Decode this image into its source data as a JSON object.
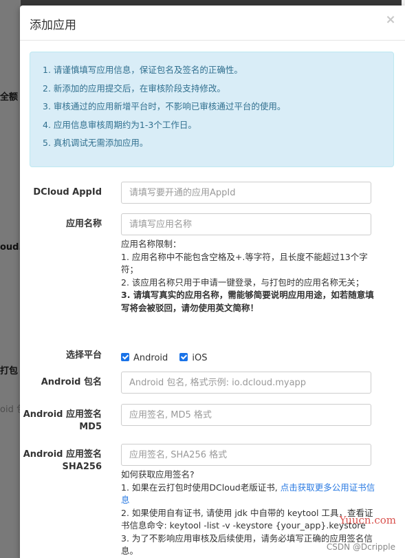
{
  "background": {
    "fragments": [
      "全额",
      "oud.g",
      "打包",
      "oid 包"
    ]
  },
  "modal": {
    "title": "添加应用",
    "close_symbol": "×"
  },
  "notice": {
    "items": [
      "1. 请谨慎填写应用信息，保证包名及签名的正确性。",
      "2. 新添加的应用提交后，在审核阶段支持修改。",
      "3. 审核通过的应用新增平台时，不影响已审核通过平台的使用。",
      "4. 应用信息审核周期约为1-3个工作日。",
      "5. 真机调试无需添加应用。"
    ]
  },
  "form": {
    "appid": {
      "label": "DCloud AppId",
      "placeholder": "请填写要开通的应用AppId",
      "value": ""
    },
    "app_name": {
      "label": "应用名称",
      "placeholder": "请填写应用名称",
      "value": "",
      "help_title": "应用名称限制：",
      "help_1": "1. 应用名称中不能包含空格及+.等字符，且长度不能超过13个字符；",
      "help_2": "2. 该应用名称只用于申请一键登录，与打包时的应用名称无关；",
      "help_3": "3. 请填写真实的应用名称，需能够简要说明应用用途，如若随意填写将会被驳回，请勿使用英文简称！"
    },
    "platform": {
      "label": "选择平台",
      "options": [
        {
          "label": "Android",
          "checked": true
        },
        {
          "label": "iOS",
          "checked": true
        }
      ]
    },
    "android_package": {
      "label": "Android 包名",
      "placeholder": "Android 包名, 格式示例: io.dcloud.myapp",
      "value": ""
    },
    "android_md5": {
      "label_line1": "Android 应用签名",
      "label_line2": "MD5",
      "placeholder": "应用签名, MD5 格式",
      "value": ""
    },
    "android_sha256": {
      "label_line1": "Android 应用签名",
      "label_line2": "SHA256",
      "placeholder": "应用签名, SHA256 格式",
      "value": "",
      "help_title": "如何获取应用签名?",
      "help_1_prefix": "1. 如果在云打包时使用DCloud老版证书,",
      "help_1_link": "点击获取更多公用证书信息",
      "help_2": "2. 如果使用自有证书, 请使用 jdk 中自带的 keytool 工具，查看证书信息命令: keytool -list -v -keystore {your_app}.keystore",
      "help_3": "3. 为了不影响应用审核及后续使用，请务必填写正确的应用签名信息。"
    }
  },
  "watermarks": {
    "yuucn": "Yuucn.com",
    "csdn": "CSDN @Dcripple"
  },
  "colors": {
    "alert_bg": "#d9edf7",
    "alert_text": "#31708f",
    "link": "#2a7ae2",
    "checkbox": "#1a73e8"
  }
}
